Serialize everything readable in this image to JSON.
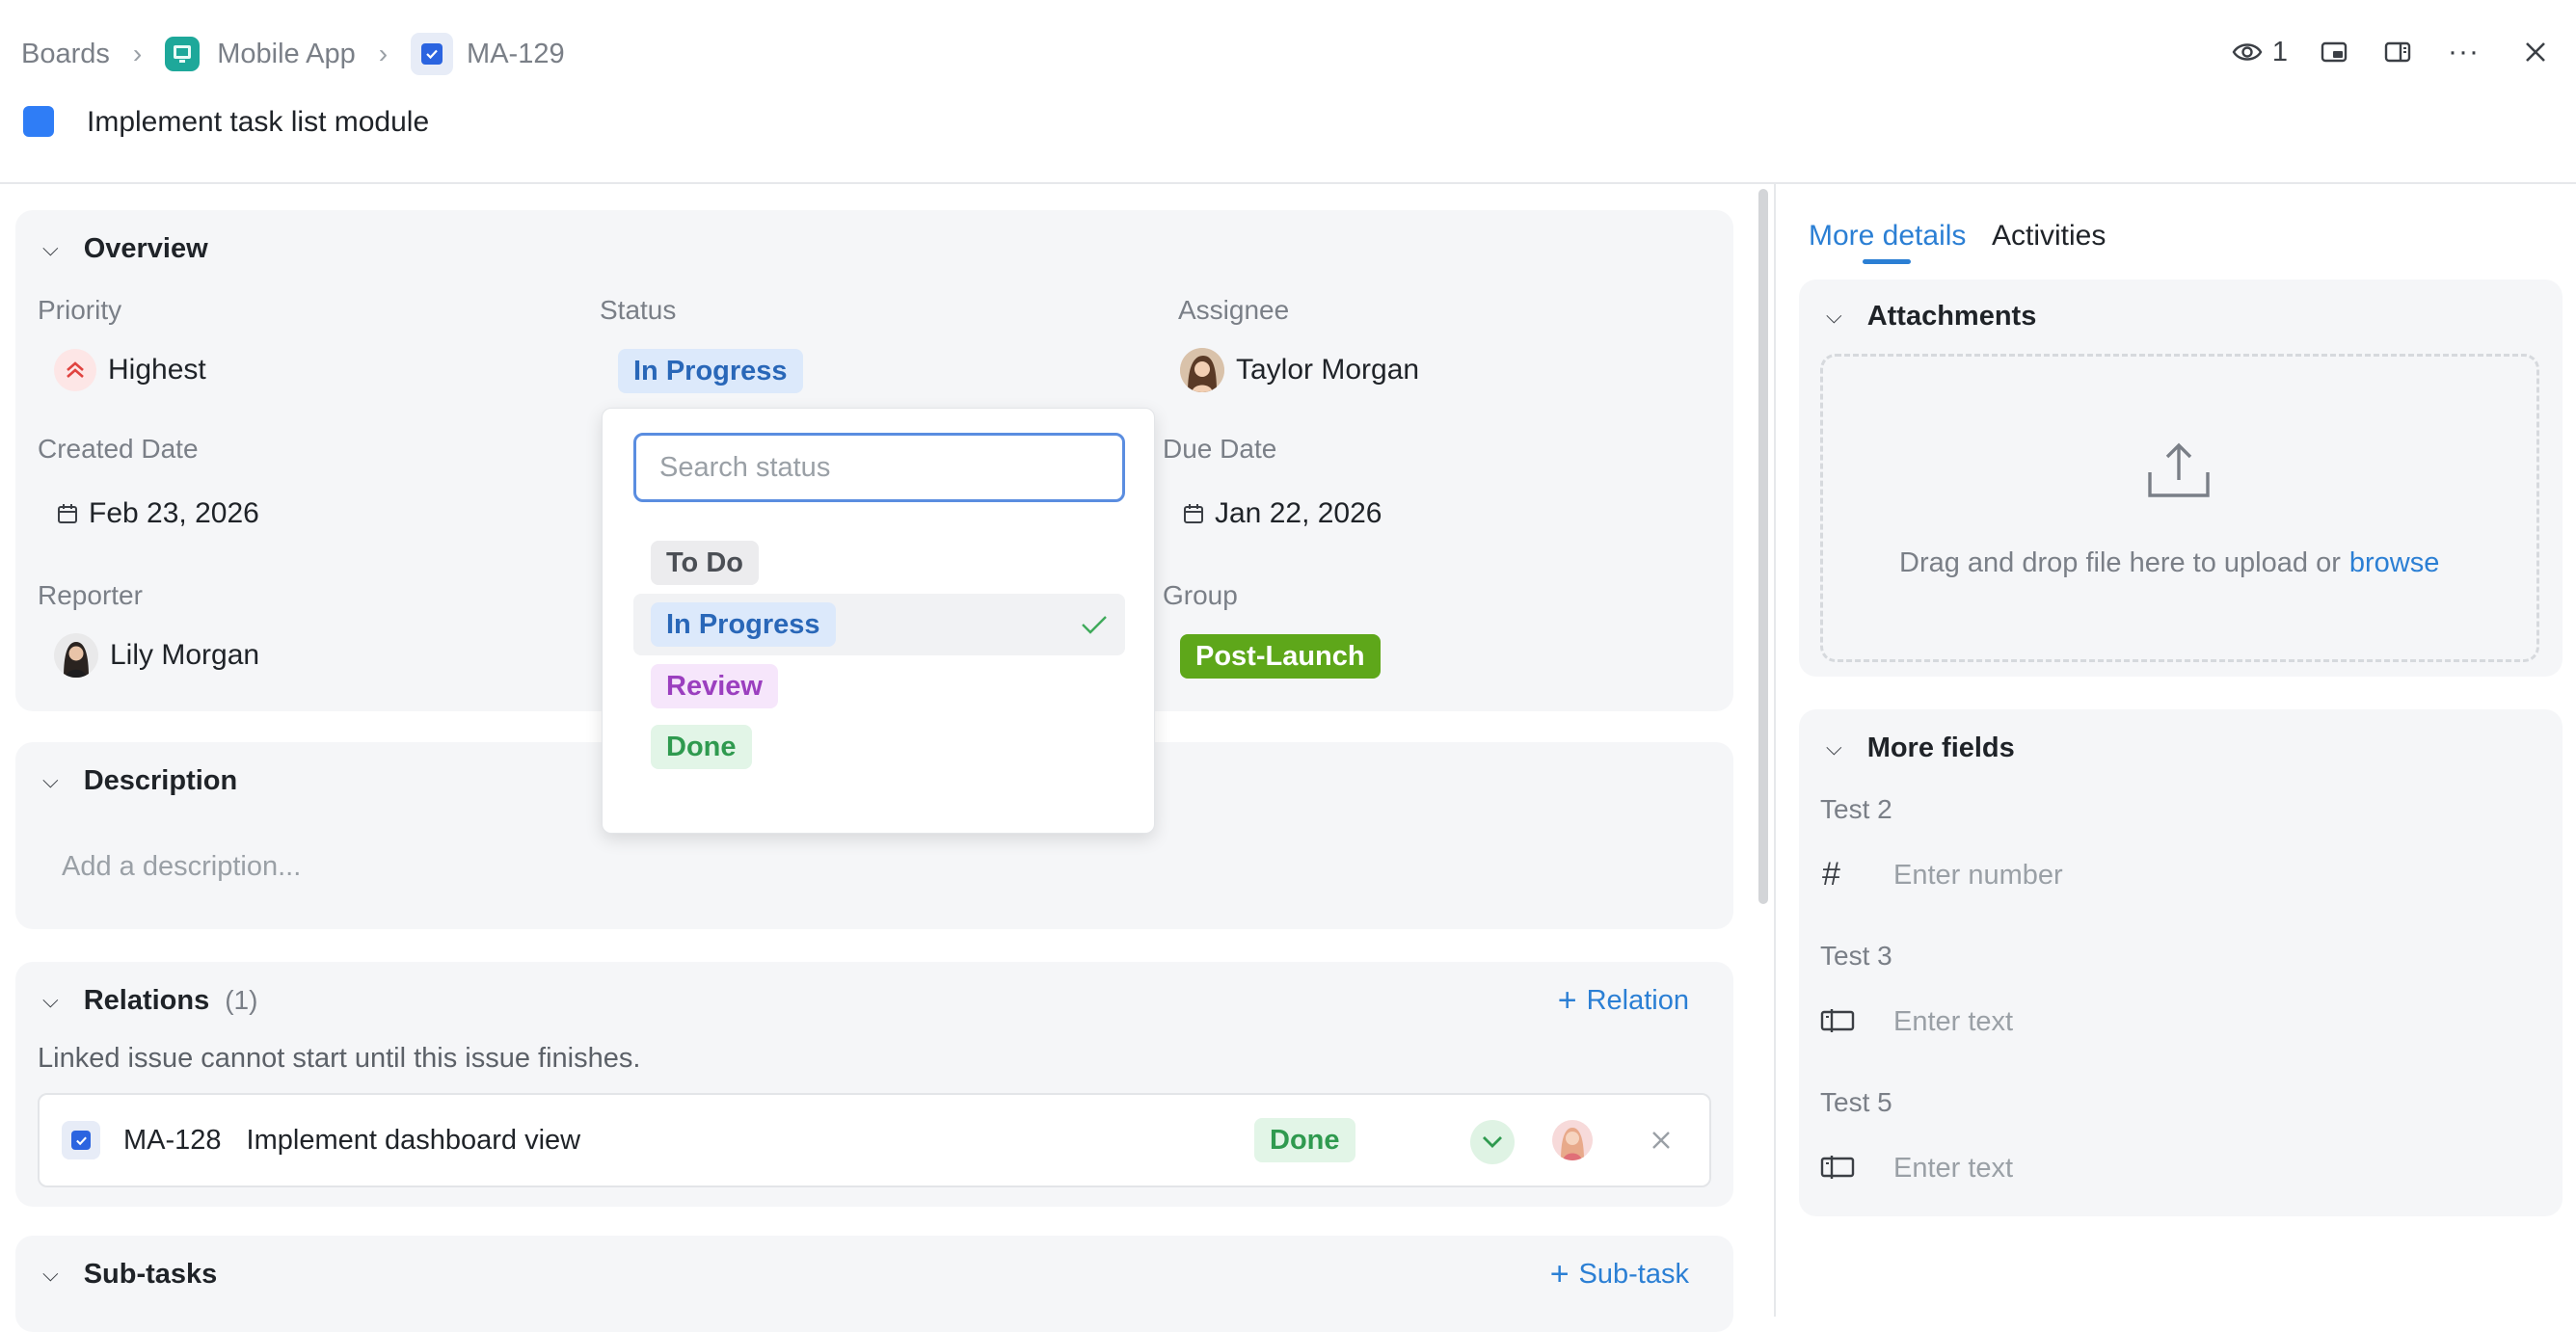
{
  "breadcrumb": {
    "boards": "Boards",
    "project": "Mobile App",
    "issue": "MA-129"
  },
  "header": {
    "watchers": "1"
  },
  "issue": {
    "title": "Implement task list module"
  },
  "overview": {
    "title": "Overview",
    "priority_label": "Priority",
    "priority_value": "Highest",
    "status_label": "Status",
    "status_value": "In Progress",
    "assignee_label": "Assignee",
    "assignee_value": "Taylor Morgan",
    "created_label": "Created Date",
    "created_value": "Feb 23, 2026",
    "due_label": "Due Date",
    "due_value": "Jan 22, 2026",
    "reporter_label": "Reporter",
    "reporter_value": "Lily Morgan",
    "group_label": "Group",
    "group_value": "Post-Launch"
  },
  "status_dropdown": {
    "placeholder": "Search status",
    "options": [
      "To Do",
      "In Progress",
      "Review",
      "Done"
    ],
    "selected": "In Progress"
  },
  "description": {
    "title": "Description",
    "placeholder": "Add a description..."
  },
  "relations": {
    "title": "Relations",
    "count": "(1)",
    "add_label": "Relation",
    "note": "Linked issue cannot start until this issue finishes.",
    "items": [
      {
        "key": "MA-128",
        "title": "Implement dashboard view",
        "status": "Done"
      }
    ]
  },
  "subtasks": {
    "title": "Sub-tasks",
    "add_label": "Sub-task"
  },
  "right_panel": {
    "tabs": [
      "More details",
      "Activities"
    ],
    "attachments": {
      "title": "Attachments",
      "drop_text": "Drag and drop file here to upload or",
      "browse": "browse"
    },
    "more_fields": {
      "title": "More fields",
      "fields": [
        {
          "label": "Test 2",
          "placeholder": "Enter number",
          "icon": "hash-icon"
        },
        {
          "label": "Test 3",
          "placeholder": "Enter text",
          "icon": "text-field-icon"
        },
        {
          "label": "Test 5",
          "placeholder": "Enter text",
          "icon": "text-field-icon"
        }
      ]
    }
  },
  "colors": {
    "accent": "#2b7fd4",
    "group": "#5ea71a",
    "title_square": "#2f7df6"
  }
}
